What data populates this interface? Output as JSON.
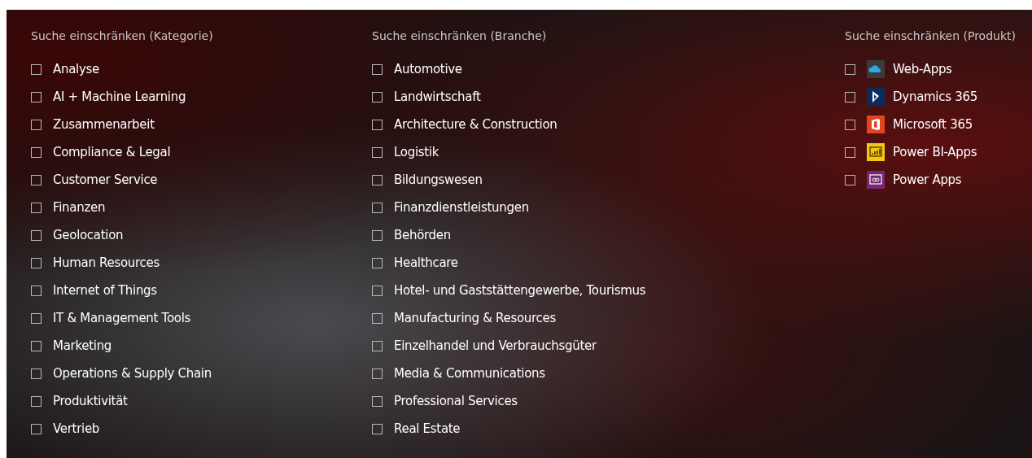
{
  "filters": [
    {
      "heading": "Suche einschränken (Kategorie)",
      "items": [
        {
          "label": "Analyse",
          "checked": false
        },
        {
          "label": "AI + Machine Learning",
          "checked": false
        },
        {
          "label": "Zusammenarbeit",
          "checked": false
        },
        {
          "label": "Compliance & Legal",
          "checked": false
        },
        {
          "label": "Customer Service",
          "checked": false
        },
        {
          "label": "Finanzen",
          "checked": false
        },
        {
          "label": "Geolocation",
          "checked": false
        },
        {
          "label": "Human Resources",
          "checked": false
        },
        {
          "label": "Internet of Things",
          "checked": false
        },
        {
          "label": "IT & Management Tools",
          "checked": false
        },
        {
          "label": "Marketing",
          "checked": false
        },
        {
          "label": "Operations & Supply Chain",
          "checked": false
        },
        {
          "label": "Produktivität",
          "checked": false
        },
        {
          "label": "Vertrieb",
          "checked": false
        }
      ]
    },
    {
      "heading": "Suche einschränken (Branche)",
      "items": [
        {
          "label": "Automotive",
          "checked": false
        },
        {
          "label": "Landwirtschaft",
          "checked": false
        },
        {
          "label": "Architecture & Construction",
          "checked": false
        },
        {
          "label": "Logistik",
          "checked": false
        },
        {
          "label": "Bildungswesen",
          "checked": false
        },
        {
          "label": "Finanzdienstleistungen",
          "checked": false
        },
        {
          "label": "Behörden",
          "checked": false
        },
        {
          "label": "Healthcare",
          "checked": false
        },
        {
          "label": "Hotel- und Gaststättengewerbe, Tourismus",
          "checked": false
        },
        {
          "label": "Manufacturing & Resources",
          "checked": false
        },
        {
          "label": "Einzelhandel und Verbrauchsgüter",
          "checked": false
        },
        {
          "label": "Media & Communications",
          "checked": false
        },
        {
          "label": "Professional Services",
          "checked": false
        },
        {
          "label": "Real Estate",
          "checked": false
        }
      ]
    },
    {
      "heading": "Suche einschränken (Produkt)",
      "items": [
        {
          "label": "Web-Apps",
          "checked": false,
          "kind": "cloud"
        },
        {
          "label": "Dynamics 365",
          "checked": false,
          "kind": "dynamics"
        },
        {
          "label": "Microsoft 365",
          "checked": false,
          "kind": "office"
        },
        {
          "label": "Power BI-Apps",
          "checked": false,
          "kind": "powerbi"
        },
        {
          "label": "Power Apps",
          "checked": false,
          "kind": "powerapps"
        }
      ]
    }
  ]
}
